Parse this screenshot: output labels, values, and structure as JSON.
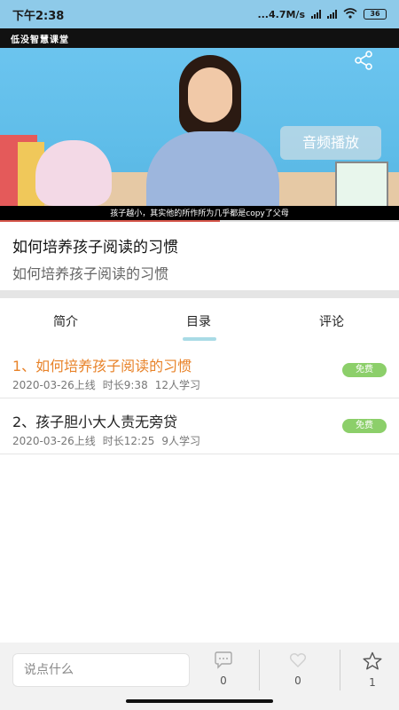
{
  "status_bar": {
    "time": "下午2:38",
    "network": "...4.7M/s",
    "battery": "36"
  },
  "video": {
    "brand": "低没智慧课堂",
    "audio_button": "音频播放",
    "subtitle": "孩子越小，其实他的所作所为几乎都是copy了父母",
    "progress": 0.55
  },
  "course": {
    "title": "如何培养孩子阅读的习惯",
    "subtitle": "如何培养孩子阅读的习惯"
  },
  "tabs": [
    {
      "label": "简介"
    },
    {
      "label": "目录"
    },
    {
      "label": "评论"
    }
  ],
  "lessons": [
    {
      "name": "1、如何培养孩子阅读的习惯",
      "date": "2020-03-26上线",
      "duration": "时长9:38",
      "learners": "12人学习",
      "badge": "免费"
    },
    {
      "name": "2、孩子胆小大人责无旁贷",
      "date": "2020-03-26上线",
      "duration": "时长12:25",
      "learners": "9人学习",
      "badge": "免费"
    }
  ],
  "bottom_bar": {
    "input_placeholder": "说点什么",
    "comments_count": "0",
    "likes_count": "0",
    "favorites_count": "1"
  }
}
